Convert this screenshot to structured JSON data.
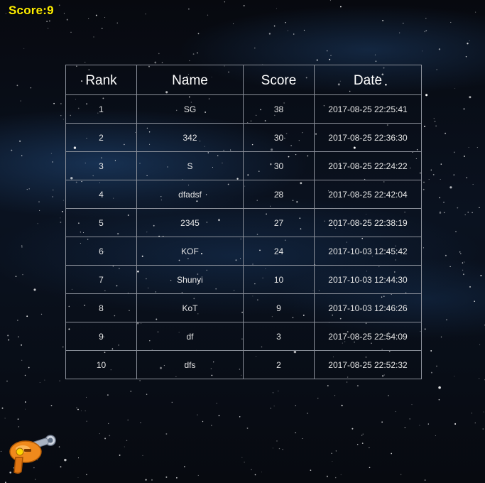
{
  "hud": {
    "score_label": "Score:9"
  },
  "leaderboard": {
    "headers": [
      "Rank",
      "Name",
      "Score",
      "Date"
    ],
    "rows": [
      [
        "1",
        "SG",
        "38",
        "2017-08-25 22:25:41"
      ],
      [
        "2",
        "342",
        "30",
        "2017-08-25 22:36:30"
      ],
      [
        "3",
        "S",
        "30",
        "2017-08-25 22:24:22"
      ],
      [
        "4",
        "dfadsf",
        "28",
        "2017-08-25 22:42:04"
      ],
      [
        "5",
        "2345",
        "27",
        "2017-08-25 22:38:19"
      ],
      [
        "6",
        "KOF",
        "24",
        "2017-10-03 12:45:42"
      ],
      [
        "7",
        "Shunyi",
        "10",
        "2017-10-03 12:44:30"
      ],
      [
        "8",
        "KoT",
        "9",
        "2017-10-03 12:46:26"
      ],
      [
        "9",
        "df",
        "3",
        "2017-08-25 22:54:09"
      ],
      [
        "10",
        "dfs",
        "2",
        "2017-08-25 22:52:32"
      ]
    ]
  },
  "colors": {
    "score_text": "#ffef00",
    "table_border": "#8a8f99",
    "gun_body": "#f08a1c"
  },
  "icons": {
    "player": "ray-gun-icon"
  }
}
